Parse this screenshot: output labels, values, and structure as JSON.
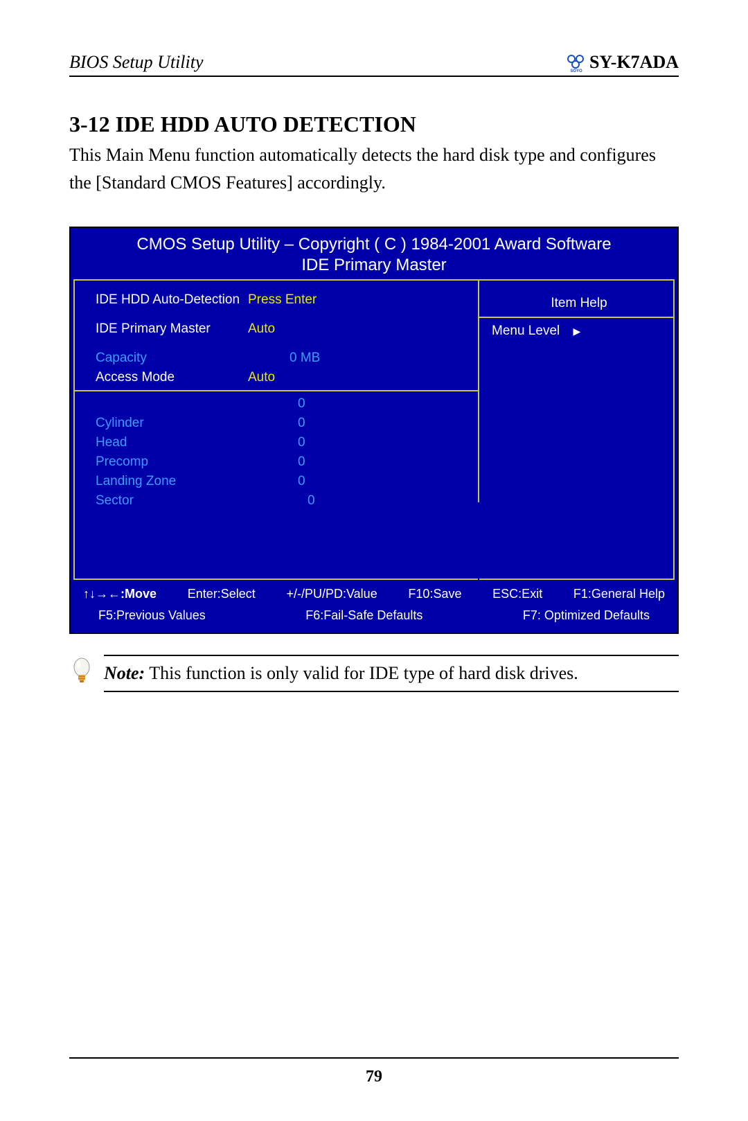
{
  "header": {
    "left": "BIOS Setup Utility",
    "right": "SY-K7ADA",
    "logo_label": "SOYO"
  },
  "section": {
    "title": "3-12  IDE HDD AUTO DETECTION",
    "body": "This Main Menu function automatically detects the hard disk type and configures the [Standard CMOS Features] accordingly."
  },
  "bios": {
    "title": "CMOS Setup Utility – Copyright ( C ) 1984-2001 Award Software",
    "subtitle": "IDE Primary Master",
    "rows": {
      "auto_detect_label": "IDE HDD Auto-Detection",
      "auto_detect_value": "Press Enter",
      "primary_label": "IDE Primary Master",
      "primary_value": "Auto",
      "capacity_label": "Capacity",
      "capacity_value": "0 MB",
      "access_label": "Access Mode",
      "access_value": "Auto",
      "blank_value": "0",
      "cylinder_label": "Cylinder",
      "cylinder_value": "0",
      "head_label": "Head",
      "head_value": "0",
      "precomp_label": "Precomp",
      "precomp_value": "0",
      "landing_label": "Landing Zone",
      "landing_value": "0",
      "sector_label": "Sector",
      "sector_value": "0"
    },
    "right": {
      "item_help": "Item Help",
      "menu_level": "Menu Level"
    },
    "footer": {
      "move": "↑↓→←:Move",
      "enter": "Enter:Select",
      "value": "+/-/PU/PD:Value",
      "f10": "F10:Save",
      "esc": "ESC:Exit",
      "f1": "F1:General Help",
      "f5": "F5:Previous Values",
      "f6": "F6:Fail-Safe Defaults",
      "f7": "F7: Optimized Defaults"
    }
  },
  "note": {
    "label": "Note:",
    "text": " This function is only valid for IDE type of hard disk drives."
  },
  "page_number": "79"
}
